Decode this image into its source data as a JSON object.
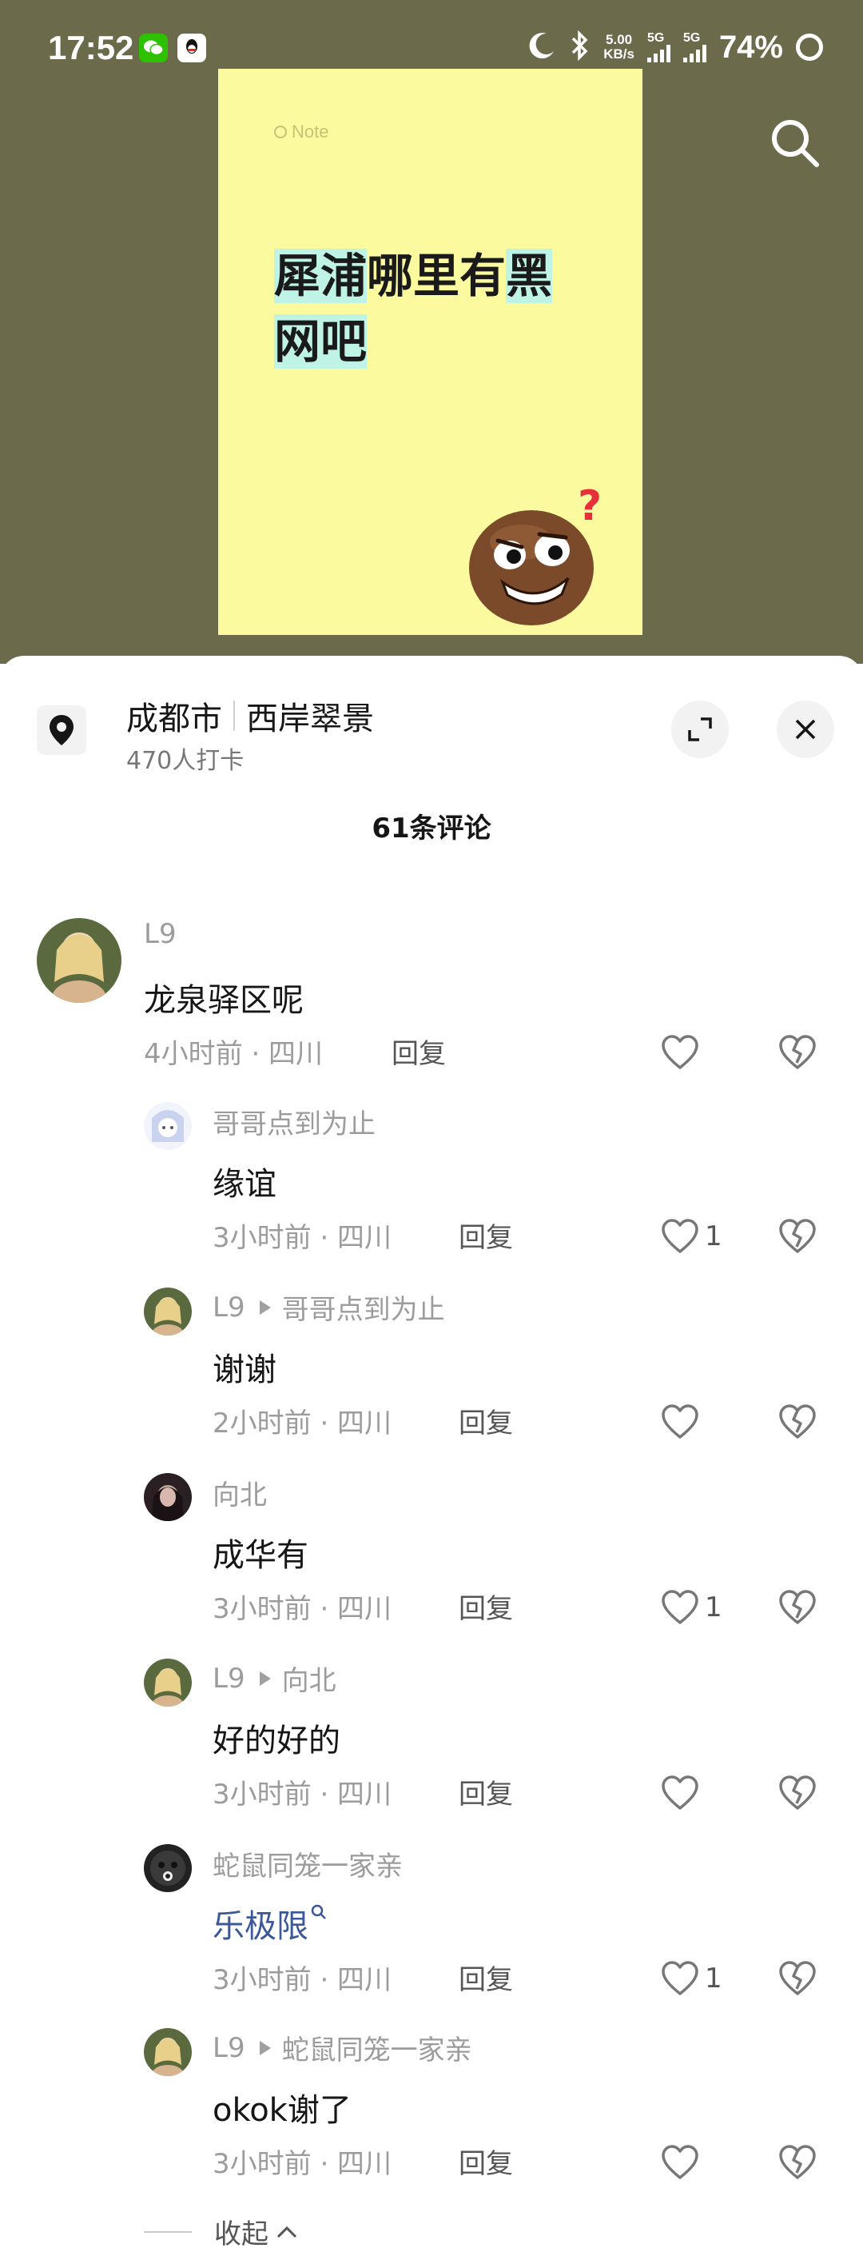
{
  "status": {
    "time": "17:52",
    "net_speed_value": "5.00",
    "net_speed_unit": "KB/s",
    "signal1_label": "5G",
    "signal2_label": "5G",
    "battery": "74%"
  },
  "note": {
    "tag": "Note",
    "title_part1": "犀浦",
    "title_part2": "哪里有",
    "title_part3": "黑",
    "title_part4": "网吧"
  },
  "location": {
    "city": "成都市",
    "place": "西岸翠景",
    "checkins": "470人打卡"
  },
  "comments_header": "61条评论",
  "comments": [
    {
      "user": "L9",
      "reply_to": "",
      "text": "龙泉驿区呢",
      "meta": "4小时前 · 四川",
      "reply": "回复",
      "likes": ""
    },
    {
      "user": "哥哥点到为止",
      "reply_to": "",
      "text": "缘谊",
      "meta": "3小时前 · 四川",
      "reply": "回复",
      "likes": "1"
    },
    {
      "user": "L9",
      "reply_to": "哥哥点到为止",
      "text": "谢谢",
      "meta": "2小时前 · 四川",
      "reply": "回复",
      "likes": ""
    },
    {
      "user": "向北",
      "reply_to": "",
      "text": "成华有",
      "meta": "3小时前 · 四川",
      "reply": "回复",
      "likes": "1"
    },
    {
      "user": "L9",
      "reply_to": "向北",
      "text": "好的好的",
      "meta": "3小时前 · 四川",
      "reply": "回复",
      "likes": ""
    },
    {
      "user": "蛇鼠同笼一家亲",
      "reply_to": "",
      "text": "乐极限",
      "meta": "3小时前 · 四川",
      "reply": "回复",
      "likes": "1"
    },
    {
      "user": "L9",
      "reply_to": "蛇鼠同笼一家亲",
      "text": "okok谢了",
      "meta": "3小时前 · 四川",
      "reply": "回复",
      "likes": ""
    }
  ],
  "collapse_label": "收起",
  "colors": {
    "background_top": "#6b6a4a",
    "note_bg": "#fcfa9e",
    "title_highlight": "#bff3e6",
    "link": "#3b5998"
  },
  "icons": [
    "wechat-icon",
    "qq-icon",
    "moon-icon",
    "bluetooth-icon",
    "search-icon",
    "location-pin-icon",
    "expand-icon",
    "close-icon",
    "heart-icon",
    "broken-heart-icon",
    "search-small-icon",
    "chevron-up-icon"
  ]
}
